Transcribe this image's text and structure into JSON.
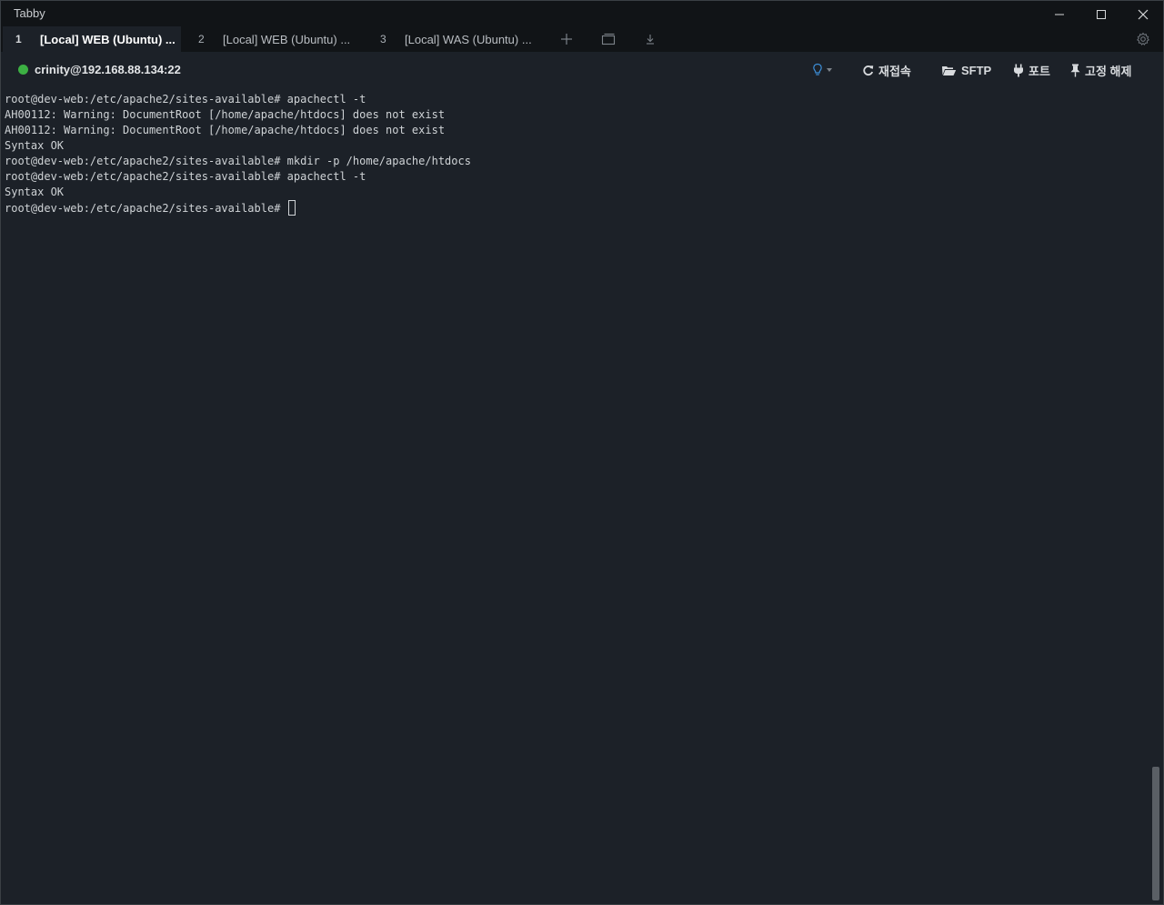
{
  "window": {
    "title": "Tabby"
  },
  "window_controls": {
    "minimize": "minimize-icon",
    "maximize": "maximize-icon",
    "close": "close-icon"
  },
  "tabs": [
    {
      "num": "1",
      "label": "[Local] WEB (Ubuntu) ...",
      "active": true
    },
    {
      "num": "2",
      "label": "[Local] WEB (Ubuntu) ...",
      "active": false
    },
    {
      "num": "3",
      "label": "[Local] WAS (Ubuntu) ...",
      "active": false
    }
  ],
  "tab_actions": {
    "new_tab": "plus-icon",
    "split": "window-icon",
    "download": "download-icon",
    "settings": "gear-icon"
  },
  "toolbar": {
    "connection_status_color": "#3cb043",
    "host": "crinity@192.168.88.134:22",
    "reconnect_label": "재접속",
    "sftp_label": "SFTP",
    "ports_label": "포트",
    "unpin_label": "고정 해제"
  },
  "terminal": {
    "lines": [
      "root@dev-web:/etc/apache2/sites-available# apachectl -t",
      "AH00112: Warning: DocumentRoot [/home/apache/htdocs] does not exist",
      "AH00112: Warning: DocumentRoot [/home/apache/htdocs] does not exist",
      "Syntax OK",
      "root@dev-web:/etc/apache2/sites-available# mkdir -p /home/apache/htdocs",
      "root@dev-web:/etc/apache2/sites-available# apachectl -t",
      "Syntax OK",
      "root@dev-web:/etc/apache2/sites-available# "
    ]
  },
  "colors": {
    "background": "#1c2128",
    "chrome": "#111417",
    "accent_blue": "#3d8fd9",
    "text": "#cfd3d6"
  }
}
